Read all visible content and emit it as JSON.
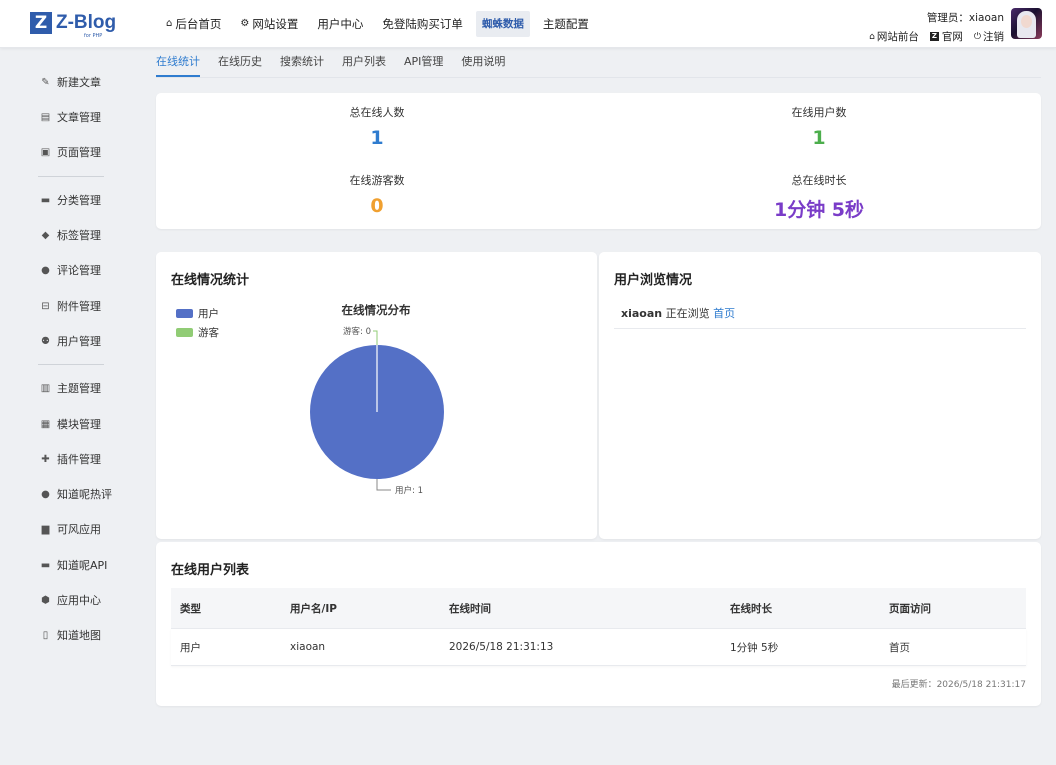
{
  "brand": {
    "mark": "Z",
    "name": "Z-Blog",
    "sub": "for PHP"
  },
  "topnav": [
    {
      "label": "后台首页",
      "icon": "home-icon"
    },
    {
      "label": "网站设置",
      "icon": "gear-icon"
    },
    {
      "label": "用户中心",
      "icon": ""
    },
    {
      "label": "免登陆购买订单",
      "icon": ""
    },
    {
      "label": "蜘蛛数据",
      "icon": "",
      "active": true
    },
    {
      "label": "主题配置",
      "icon": ""
    }
  ],
  "user": {
    "admin_label": "管理员：xiaoan",
    "links": [
      "网站前台",
      "官网",
      "注销"
    ]
  },
  "sidebar": [
    {
      "label": "新建文章",
      "icon": "edit-icon"
    },
    {
      "label": "文章管理",
      "icon": "article-icon"
    },
    {
      "label": "页面管理",
      "icon": "page-icon"
    },
    {
      "label": "分类管理",
      "icon": "folder-icon"
    },
    {
      "label": "标签管理",
      "icon": "tag-icon"
    },
    {
      "label": "评论管理",
      "icon": "comment-icon"
    },
    {
      "label": "附件管理",
      "icon": "attachment-icon"
    },
    {
      "label": "用户管理",
      "icon": "users-icon"
    },
    {
      "label": "主题管理",
      "icon": "theme-icon"
    },
    {
      "label": "模块管理",
      "icon": "grid-icon"
    },
    {
      "label": "插件管理",
      "icon": "puzzle-icon"
    },
    {
      "label": "知道呢热评",
      "icon": "chat-icon"
    },
    {
      "label": "可风应用",
      "icon": "bag-icon"
    },
    {
      "label": "知道呢API",
      "icon": "card-icon"
    },
    {
      "label": "应用中心",
      "icon": "box-icon"
    },
    {
      "label": "知道地图",
      "icon": "map-icon"
    }
  ],
  "tabs": [
    "在线统计",
    "在线历史",
    "搜索统计",
    "用户列表",
    "API管理",
    "使用说明"
  ],
  "stats": {
    "total_online": {
      "label": "总在线人数",
      "value": "1",
      "color": "#2f7ccf"
    },
    "online_users": {
      "label": "在线用户数",
      "value": "1",
      "color": "#4cae4c"
    },
    "online_guests": {
      "label": "在线游客数",
      "value": "0",
      "color": "#f0a030"
    },
    "total_duration": {
      "label": "总在线时长",
      "value": "1分钟 5秒",
      "color": "#7a3cc8"
    }
  },
  "online_chart": {
    "title": "在线情况统计",
    "legend": [
      {
        "label": "用户",
        "color": "#5470c6"
      },
      {
        "label": "游客",
        "color": "#91cc75"
      }
    ]
  },
  "chart_data": {
    "type": "pie",
    "title": "在线情况分布",
    "slices": [
      {
        "name": "用户",
        "value": 1,
        "color": "#5470c6"
      },
      {
        "name": "游客",
        "value": 0,
        "color": "#91cc75"
      }
    ],
    "labels": {
      "user": "用户: 1",
      "guest": "游客: 0"
    },
    "legend_position": "top-left"
  },
  "browsing": {
    "title": "用户浏览情况",
    "rows": [
      {
        "user": "xiaoan",
        "action": " 正在浏览 ",
        "page": "首页"
      }
    ]
  },
  "online_list": {
    "title": "在线用户列表",
    "columns": [
      "类型",
      "用户名/IP",
      "在线时间",
      "在线时长",
      "页面访问"
    ],
    "rows": [
      [
        "用户",
        "xiaoan",
        "2026/5/18 21:31:13",
        "1分钟 5秒",
        "首页"
      ]
    ],
    "updated": "最后更新：2026/5/18 21:31:17"
  }
}
